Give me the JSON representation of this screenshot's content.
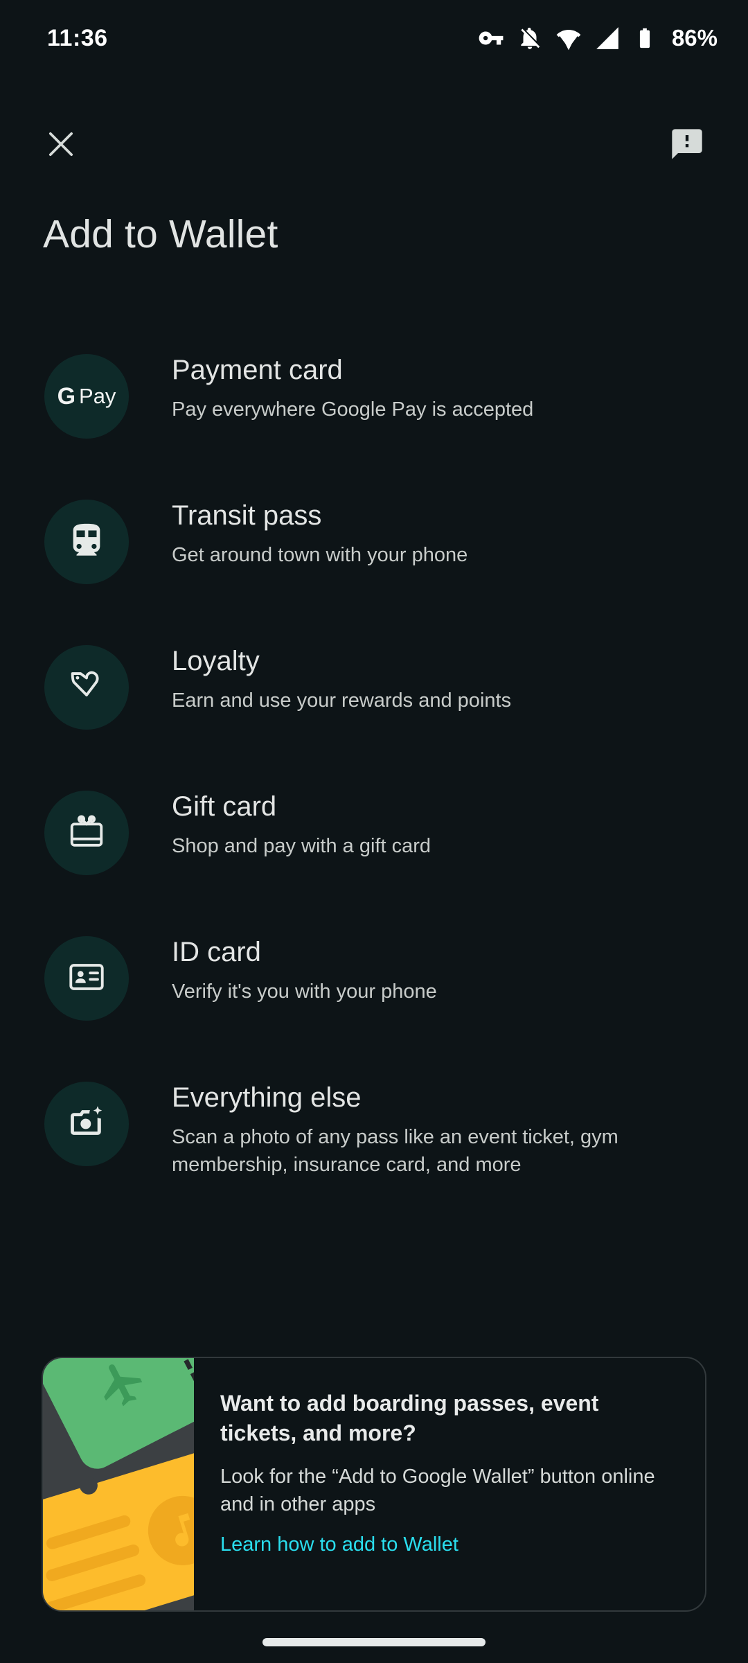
{
  "status_bar": {
    "clock": "11:36",
    "battery_percent": "86%",
    "icons": [
      "vpn-key-icon",
      "notifications-muted-icon",
      "wifi-icon",
      "cellular-signal-icon",
      "battery-icon"
    ]
  },
  "app_bar": {
    "close_label": "close-icon",
    "feedback_label": "feedback-icon"
  },
  "page_title": "Add to Wallet",
  "list": {
    "items": [
      {
        "icon": "google-pay-icon",
        "title": "Payment card",
        "subtitle": "Pay everywhere Google Pay is accepted",
        "gpay_g": "G",
        "gpay_pay": "Pay"
      },
      {
        "icon": "transit-train-icon",
        "title": "Transit pass",
        "subtitle": "Get around town with your phone"
      },
      {
        "icon": "loyalty-tag-heart-icon",
        "title": "Loyalty",
        "subtitle": "Earn and use your rewards and points"
      },
      {
        "icon": "gift-card-icon",
        "title": "Gift card",
        "subtitle": "Shop and pay with a gift card"
      },
      {
        "icon": "id-badge-icon",
        "title": "ID card",
        "subtitle": "Verify it's you with your phone"
      },
      {
        "icon": "camera-sparkle-icon",
        "title": "Everything else",
        "subtitle": "Scan a photo of any pass like an event ticket, gym membership, insurance card, and more"
      }
    ]
  },
  "promo_card": {
    "illustration": "boarding-pass-and-event-ticket-illustration",
    "title": "Want to add boarding passes, event tickets, and more?",
    "description": "Look for the “Add to Google Wallet” button online and in other apps",
    "link": "Learn how to add to Wallet"
  },
  "colors": {
    "background": "#0d1417",
    "icon_circle": "#0e2a29",
    "link": "#2adeee",
    "promo_art_bg": "#3c4043",
    "ticket_green": "#5bb974",
    "ticket_yellow": "#fdbc2c",
    "text_primary": "#e3e5e4",
    "text_secondary": "#c8ccca"
  }
}
